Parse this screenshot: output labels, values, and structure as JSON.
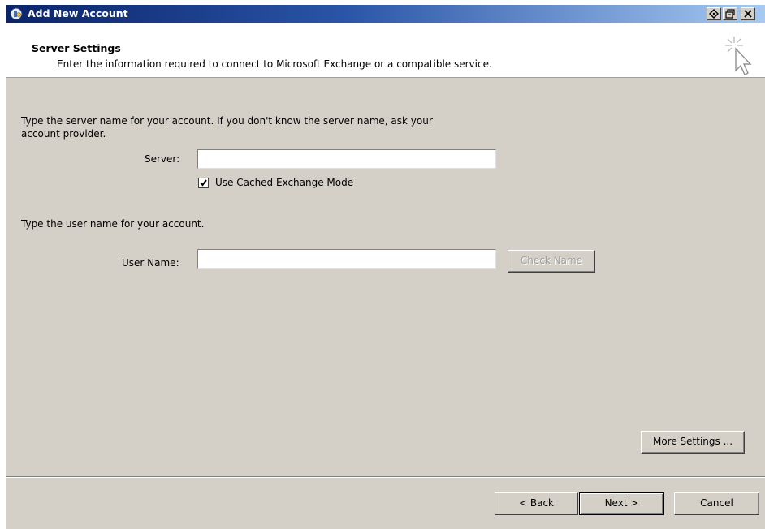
{
  "window": {
    "title": "Add New Account"
  },
  "header": {
    "title": "Server Settings",
    "subtitle": "Enter the information required to connect to Microsoft Exchange or a compatible service."
  },
  "server_section": {
    "instruction_line1": "Type the server name for your account. If you don't know the server name, ask your",
    "instruction_line2": "account provider.",
    "server_label": "Server:",
    "server_value": "",
    "cached_mode_label": "Use Cached Exchange Mode",
    "cached_mode_checked": true
  },
  "user_section": {
    "instruction": "Type the user name for your account.",
    "user_label": "User Name:",
    "user_value": "",
    "check_name_label": "Check Name"
  },
  "buttons": {
    "more_settings": "More Settings ...",
    "back": "< Back",
    "next": "Next >",
    "cancel": "Cancel"
  },
  "icons": {
    "app": "outlook-account-icon",
    "help": "help-icon",
    "restore": "restore-icon",
    "close": "close-icon",
    "header": "cursor-sparkle-icon"
  }
}
